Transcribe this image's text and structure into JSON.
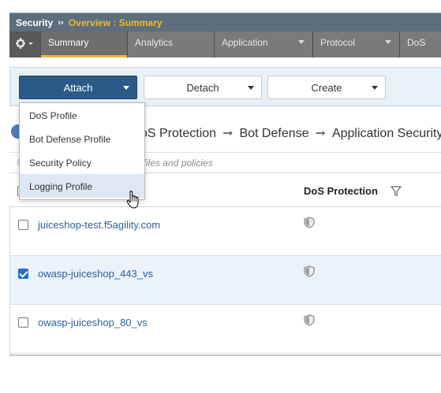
{
  "breadcrumb": {
    "section": "Security",
    "separator": "››",
    "path": "Overview : Summary"
  },
  "tabs": [
    {
      "label": "Summary",
      "active": true,
      "has_menu": false
    },
    {
      "label": "Analytics",
      "active": false,
      "has_menu": false
    },
    {
      "label": "Application",
      "active": false,
      "has_menu": true
    },
    {
      "label": "Protocol",
      "active": false,
      "has_menu": true
    },
    {
      "label": "DoS",
      "active": false,
      "has_menu": false
    }
  ],
  "toolbar": {
    "attach_label": "Attach",
    "detach_label": "Detach",
    "create_label": "Create"
  },
  "attach_menu": {
    "items": [
      {
        "label": "DoS Profile",
        "hover": false
      },
      {
        "label": "Bot Defense Profile",
        "hover": false
      },
      {
        "label": "Security Policy",
        "hover": false
      },
      {
        "label": "Logging Profile",
        "hover": true
      }
    ]
  },
  "flow": {
    "steps": [
      "oS Protection",
      "Bot Defense",
      "Application Security"
    ]
  },
  "hint_text": "ofiles and policies",
  "table": {
    "dos_column": "DoS Protection",
    "rows": [
      {
        "name": "juiceshop-test.f5agility.com",
        "checked": false
      },
      {
        "name": "owasp-juiceshop_443_vs",
        "checked": true
      },
      {
        "name": "owasp-juiceshop_80_vs",
        "checked": false
      }
    ]
  },
  "colors": {
    "accent": "#f2b632",
    "primary": "#2b5a89",
    "link": "#2f5f9a"
  },
  "icons": {
    "gear": "gear-icon",
    "filter": "filter-icon",
    "shield": "shield-icon",
    "cursor": "hand-cursor-icon"
  }
}
